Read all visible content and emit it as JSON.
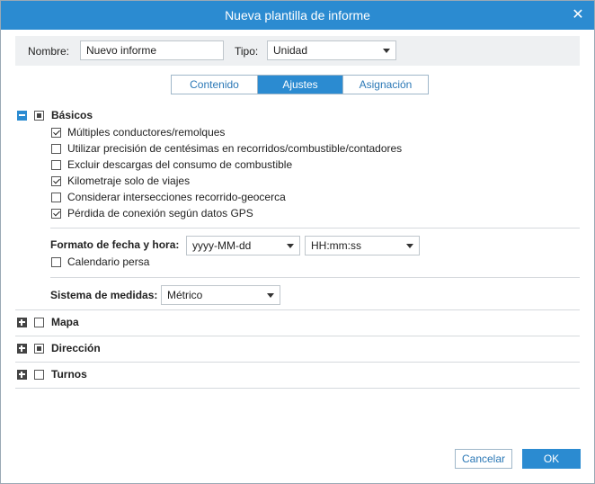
{
  "dialog": {
    "title": "Nueva plantilla de informe"
  },
  "header": {
    "name_label": "Nombre:",
    "name_value": "Nuevo informe",
    "type_label": "Tipo:",
    "type_value": "Unidad"
  },
  "tabs": [
    {
      "label": "Contenido",
      "active": false
    },
    {
      "label": "Ajustes",
      "active": true
    },
    {
      "label": "Asignación",
      "active": false
    }
  ],
  "basics": {
    "title": "Básicos",
    "options": [
      {
        "label": "Múltiples conductores/remolques",
        "checked": true
      },
      {
        "label": "Utilizar precisión de centésimas en recorridos/combustible/contadores",
        "checked": false
      },
      {
        "label": "Excluir descargas del consumo de combustible",
        "checked": false
      },
      {
        "label": "Kilometraje solo de viajes",
        "checked": true
      },
      {
        "label": "Considerar intersecciones recorrido-geocerca",
        "checked": false
      },
      {
        "label": "Pérdida de conexión según datos GPS",
        "checked": true
      }
    ],
    "date_format_label": "Formato de fecha y hora:",
    "date_format_value": "yyyy-MM-dd",
    "time_format_value": "HH:mm:ss",
    "persian_calendar_label": "Calendario persa",
    "persian_calendar_checked": false,
    "measure_label": "Sistema de medidas:",
    "measure_value": "Métrico"
  },
  "sections": [
    {
      "title": "Mapa"
    },
    {
      "title": "Dirección"
    },
    {
      "title": "Turnos"
    }
  ],
  "footer": {
    "cancel_label": "Cancelar",
    "ok_label": "OK"
  }
}
